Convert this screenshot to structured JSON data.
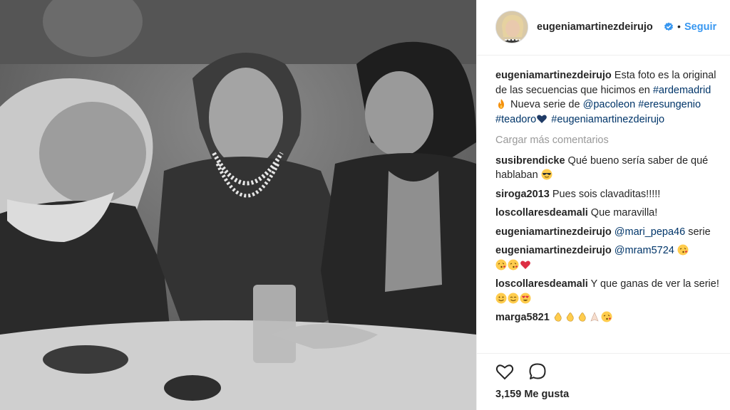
{
  "post": {
    "author": "eugeniamartinezdeirujo",
    "follow_label": "Seguir",
    "dot": "•",
    "caption": {
      "text_1": "Esta foto es la original de las secuencias que hicimos en",
      "hashtag_1": "#ardemadrid",
      "text_2": " Nueva serie de",
      "mention_1": "@pacoleon",
      "hashtag_2": "#eresungenio",
      "hashtag_3": "#teadoro",
      "hashtag_4": "#eugeniamartinezdeirujo"
    },
    "load_more_label": "Cargar más comentarios",
    "comments": [
      {
        "user": "susibrendicke",
        "text": "Qué bueno sería saber de qué hablaban"
      },
      {
        "user": "siroga2013",
        "text": "Pues sois clavaditas!!!!!"
      },
      {
        "user": "loscollaresdeamali",
        "text": "Que maravilla!"
      },
      {
        "user": "eugeniamartinezdeirujo",
        "mention": "@mari_pepa46",
        "text": "serie"
      },
      {
        "user": "eugeniamartinezdeirujo",
        "mention": "@mram5724",
        "text": ""
      },
      {
        "user": "loscollaresdeamali",
        "text": "Y que ganas de ver la serie!"
      },
      {
        "user": "marga5821",
        "text": ""
      }
    ],
    "likes_label": "3,159 Me gusta"
  },
  "icons": {
    "verified": "verified-badge-icon",
    "like": "heart-outline-icon",
    "comment": "comment-bubble-icon",
    "fire": "fire-emoji",
    "blue_heart": "blue-heart-emoji",
    "sunglasses": "sunglasses-emoji",
    "kiss": "kiss-emoji",
    "red_heart": "red-heart-emoji",
    "smile": "smile-emoji",
    "heart_eyes": "heart-eyes-emoji",
    "clap": "clap-emoji",
    "pray": "folded-hands-emoji"
  },
  "colors": {
    "link_blue": "#3897f0",
    "hashtag_navy": "#003569",
    "muted_gray": "#999999",
    "text": "#262626"
  }
}
